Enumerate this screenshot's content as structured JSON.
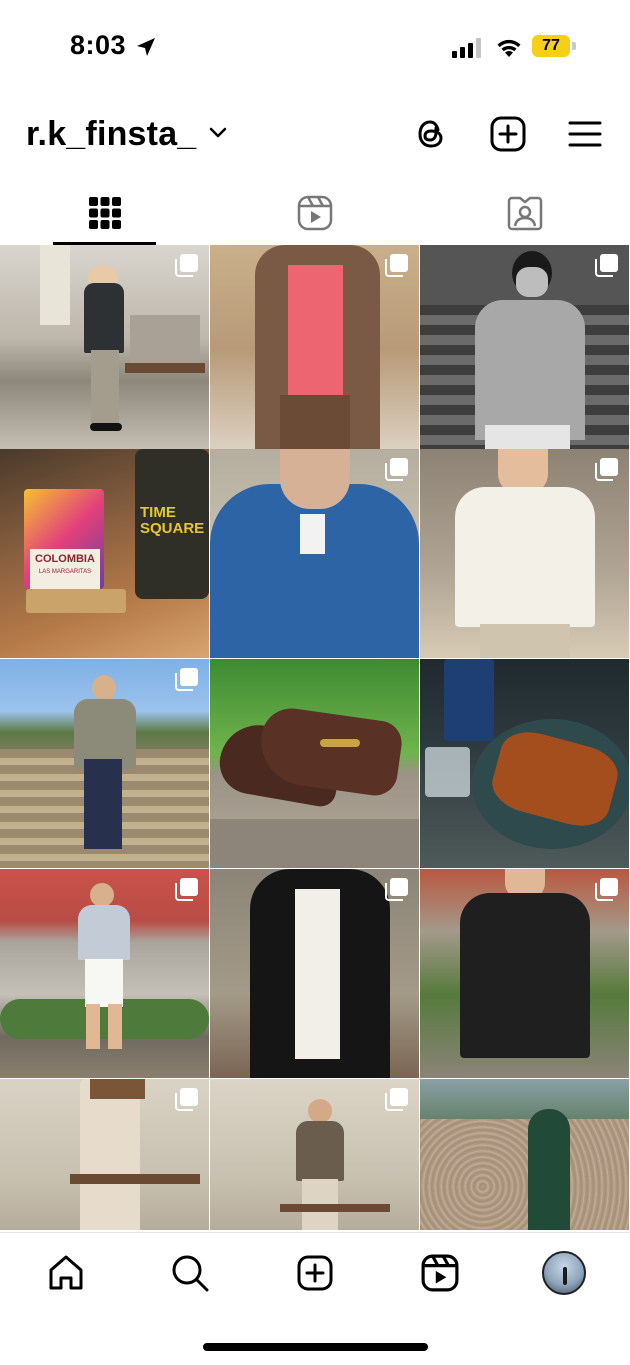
{
  "status": {
    "time": "8:03",
    "battery": "77"
  },
  "profile": {
    "username": "r.k_finsta_"
  },
  "icons": {
    "threads": "threads-icon",
    "new_post": "plus-square-icon",
    "menu": "hamburger-menu-icon",
    "grid_tab": "grid-icon",
    "reels_tab": "reels-icon",
    "tagged_tab": "tagged-person-icon"
  },
  "grid": {
    "posts": [
      {
        "scene": "mall-man-dark-shirt",
        "multi": true
      },
      {
        "scene": "brown-jacket-pink-tee",
        "multi": true
      },
      {
        "scene": "bw-man-steps",
        "multi": true
      },
      {
        "scene": "colombia-coffee-bag",
        "multi": false,
        "text": [
          "COLOMBIA",
          "LAS MARGARITAS",
          "TIME",
          "SQUARE"
        ]
      },
      {
        "scene": "blue-linen-shirt",
        "multi": true
      },
      {
        "scene": "white-knit-tee",
        "multi": true
      },
      {
        "scene": "man-stairs-jacket",
        "multi": true
      },
      {
        "scene": "brown-loafers",
        "multi": false
      },
      {
        "scene": "unagi-bowl-sake",
        "multi": false
      },
      {
        "scene": "man-vneck-shorts",
        "multi": true
      },
      {
        "scene": "black-jacket-white-tee",
        "multi": true
      },
      {
        "scene": "black-linen-shirt",
        "multi": true
      },
      {
        "scene": "beige-trousers",
        "multi": true
      },
      {
        "scene": "mall-man-brown-shirt",
        "multi": true
      },
      {
        "scene": "green-paisley-tie",
        "multi": false
      }
    ]
  },
  "bottom_nav": [
    "home-icon",
    "search-icon",
    "create-icon",
    "reels-icon",
    "profile-avatar"
  ],
  "colors": {
    "battery": "#f5d018",
    "text": "#000000"
  }
}
